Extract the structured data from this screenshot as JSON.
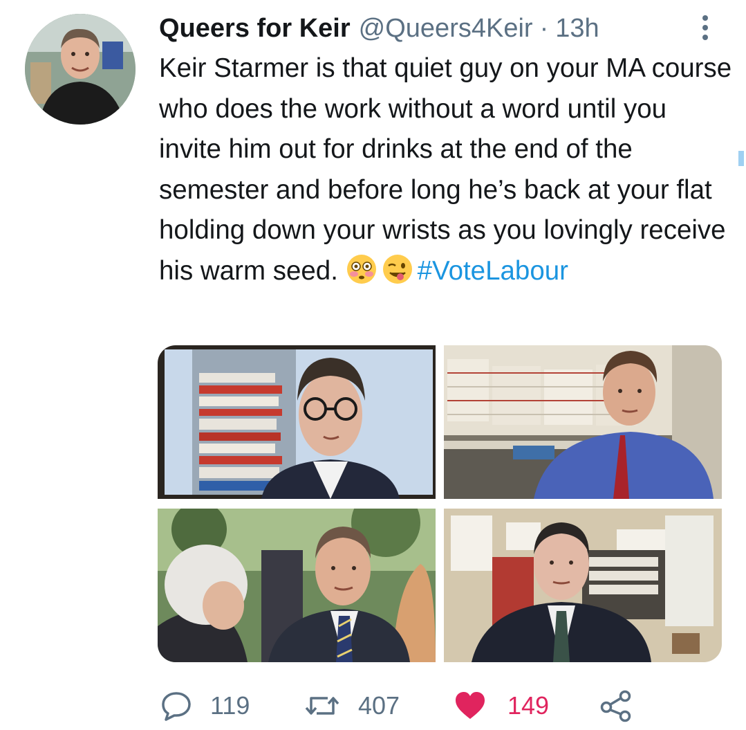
{
  "tweet": {
    "display_name": "Queers for Keir",
    "handle": "@Queers4Keir",
    "separator": "·",
    "time": "13h",
    "text": "Keir Starmer is that quiet guy on your MA course who does the work without a word until you invite him out for drinks at the end of the semester and before long he’s back at your flat holding down your wrists as you lovingly receive his warm seed.",
    "emojis": [
      "flushed-face-icon",
      "winking-face-with-tongue-icon"
    ],
    "hashtag": "#VoteLabour",
    "accent_color": "#1b95e0",
    "like_color": "#e0245e",
    "secondary_text_color": "#5b7083"
  },
  "media": [
    {
      "name": "photo-man-glasses-files"
    },
    {
      "name": "photo-man-office-shelves"
    },
    {
      "name": "photo-man-crowd-outdoors"
    },
    {
      "name": "photo-man-office-desk"
    }
  ],
  "actions": {
    "reply_count": "119",
    "retweet_count": "407",
    "like_count": "149"
  }
}
